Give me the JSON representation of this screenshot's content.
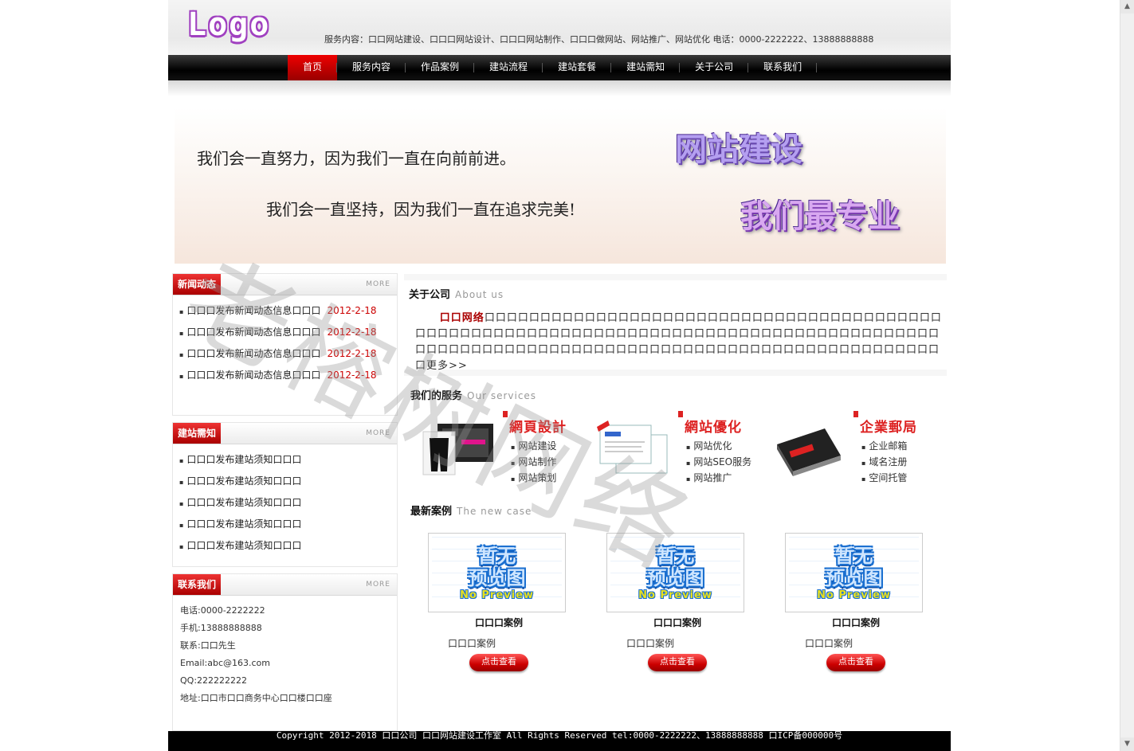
{
  "header": {
    "logo": "Logo",
    "info": "服务内容：口口网站建设、口口口网站设计、口口口网站制作、口口口做网站、网站推广、网站优化  电话：0000-2222222、13888888888"
  },
  "nav": {
    "items": [
      "首页",
      "服务内容",
      "作品案例",
      "建站流程",
      "建站套餐",
      "建站需知",
      "关于公司",
      "联系我们"
    ]
  },
  "banner": {
    "line1": "我们会一直努力，因为我们一直在向前前进。",
    "line2": "我们会一直坚持，因为我们一直在追求完美!",
    "big1": "网站建设",
    "big2": "我们最专业"
  },
  "news": {
    "title": "新闻动态",
    "more": "MORE",
    "items": [
      {
        "text": "口口口发布新闻动态信息口口口",
        "date": "2012-2-18"
      },
      {
        "text": "口口口发布新闻动态信息口口口",
        "date": "2012-2-18"
      },
      {
        "text": "口口口发布新闻动态信息口口口",
        "date": "2012-2-18"
      },
      {
        "text": "口口口发布新闻动态信息口口口",
        "date": "2012-2-18"
      }
    ]
  },
  "notice": {
    "title": "建站需知",
    "more": "MORE",
    "items": [
      "口口口发布建站须知口口口",
      "口口口发布建站须知口口口",
      "口口口发布建站须知口口口",
      "口口口发布建站须知口口口",
      "口口口发布建站须知口口口"
    ]
  },
  "contact": {
    "title": "联系我们",
    "more": "MORE",
    "items": [
      "电话:0000-2222222",
      "手机:13888888888",
      "联系:口口先生",
      "Email:abc@163.com",
      "QQ:222222222",
      "地址:口口市口口商务中心口口楼口口座"
    ]
  },
  "about": {
    "title": "关于公司",
    "subtitle": "About us",
    "company": "口口网络",
    "text": "口口口口口口口口口口口口口口口口口口口口口口口口口口口口口口口口口口口口口口口口口口口口口口口口口口口口口口口口口口口口口口口口口口口口口口口口口口口口口口口口口口口口口口口口口口口口口口口口口口口口口口口口口口口口口口口口口口口口口口口口口口口口口口口口口口口口口口口口",
    "more_link": "更多>>"
  },
  "services": {
    "title": "我们的服务",
    "subtitle": "Our services",
    "items": [
      {
        "name": "網頁設計",
        "list": [
          "网站建设",
          "网站制作",
          "网站策划"
        ]
      },
      {
        "name": "網站優化",
        "list": [
          "网站优化",
          "网站SEO服务",
          "网站推广"
        ]
      },
      {
        "name": "企業郵局",
        "list": [
          "企业邮箱",
          "域名注册",
          "空间托管"
        ]
      }
    ]
  },
  "cases": {
    "title": "最新案例",
    "subtitle": "The new case",
    "preview_line1": "暂无",
    "preview_line2": "预览图",
    "preview_line3": "No Preview",
    "items": [
      {
        "name": "口口口案例",
        "desc": "口口口案例",
        "button": "点击查看"
      },
      {
        "name": "口口口案例",
        "desc": "口口口案例",
        "button": "点击查看"
      },
      {
        "name": "口口口案例",
        "desc": "口口口案例",
        "button": "点击查看"
      }
    ]
  },
  "footer": {
    "text": "Copyright 2012-2018   口口公司 口口网站建设工作室 All Rights Reserved tel:0000-2222222、13888888888    口ICP备000000号"
  },
  "watermark": "老榕树网络"
}
